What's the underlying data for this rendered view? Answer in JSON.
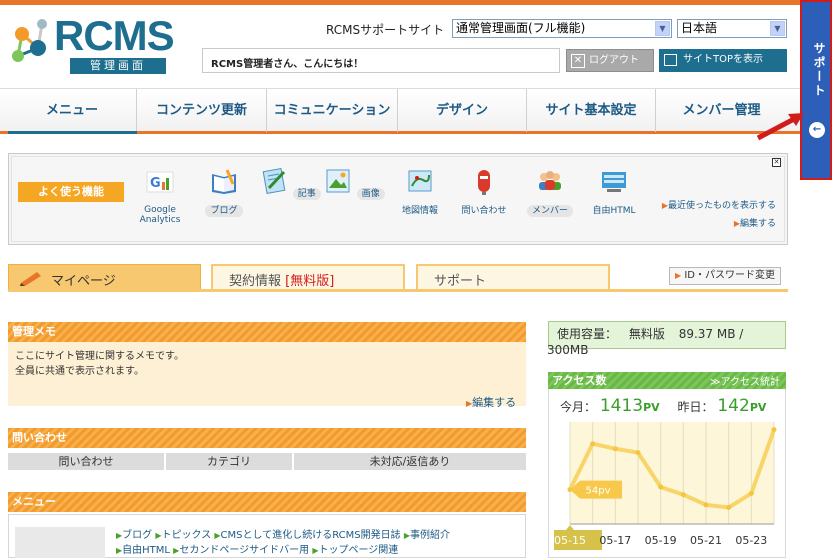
{
  "header": {
    "logo_text": "RCMS",
    "logo_sub": "管理画面",
    "site_label": "RCMSサポートサイト",
    "mode_select": "通常管理画面(フル機能)",
    "lang_select": "日本語",
    "greeting": "RCMS管理者さん、こんにちは！",
    "logout": "ログアウト",
    "site_top": "サイトTOPを表示"
  },
  "nav": [
    "メニュー",
    "コンテンツ更新",
    "コミュニケーション",
    "デザイン",
    "サイト基本設定",
    "メンバー管理"
  ],
  "support_tab": "サポート",
  "quick": {
    "label": "よく使う機能",
    "items": [
      "Google Analytics",
      "ブログ",
      "記事",
      "画像",
      "地図情報",
      "問い合わせ",
      "メンバー",
      "自由HTML"
    ],
    "recent": "最近使ったものを表示する",
    "edit": "編集する"
  },
  "tabs": {
    "mypage": "マイページ",
    "contract": "契約情報",
    "contract_tag": "[無料版]",
    "support": "サポート",
    "id_pw": "ID・パスワード変更"
  },
  "memo": {
    "title": "管理メモ",
    "line1": "ここにサイト管理に関するメモです。",
    "line2": "全員に共通で表示されます。",
    "edit": "編集する"
  },
  "inquiry": {
    "title": "問い合わせ",
    "columns": [
      "問い合わせ",
      "カテゴリ",
      "未対応/返信あり"
    ]
  },
  "menu_section": {
    "title": "メニュー",
    "row1": [
      "ブログ",
      "トピックス",
      "CMSとして進化し続けるRCMS開発日誌",
      "事例紹介"
    ],
    "row2": [
      "自由HTML",
      "セカンドページサイドバー用",
      "トップページ関連"
    ]
  },
  "usage": {
    "label": "使用容量：",
    "plan": "無料版",
    "used": "89.37 MB /",
    "total": "300MB"
  },
  "access": {
    "title": "アクセス数",
    "stats_link": "アクセス統計",
    "today_label": "今月：",
    "today_value": "1413",
    "yesterday_label": "昨日：",
    "yesterday_value": "142",
    "unit": "PV",
    "tooltip": "54pv"
  },
  "chart_data": {
    "type": "line",
    "x": [
      "05-15",
      "05-16",
      "05-17",
      "05-18",
      "05-19",
      "05-20",
      "05-21",
      "05-22",
      "05-23",
      "05-24"
    ],
    "tick_labels": [
      "05-15",
      "05-17",
      "05-19",
      "05-21",
      "05-23"
    ],
    "values": [
      54,
      126,
      118,
      112,
      58,
      46,
      30,
      26,
      48,
      148
    ],
    "ylim": [
      0,
      160
    ],
    "grid": true
  }
}
